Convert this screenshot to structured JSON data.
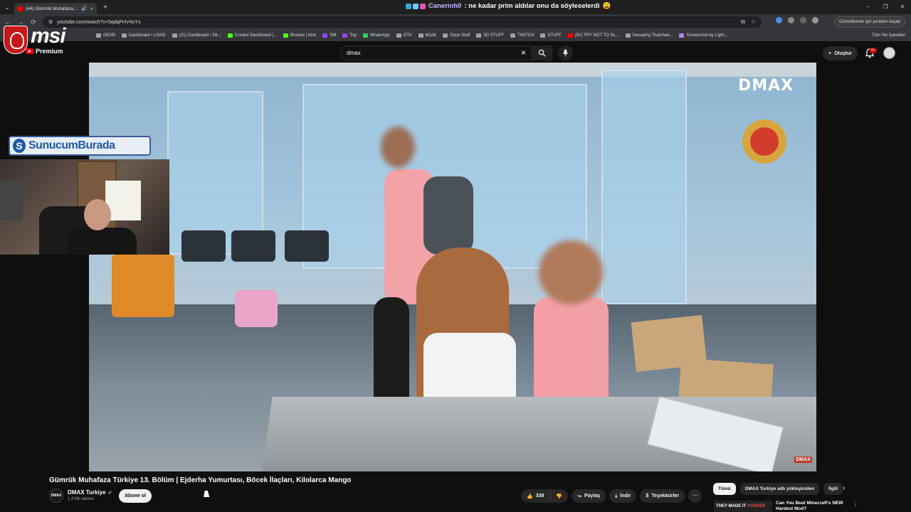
{
  "browser": {
    "tab": {
      "title": "(44) Gümrük Muhafaza Türk",
      "icon": "youtube-icon"
    },
    "url": "youtube.com/watch?v=5qdqFHV4oYs",
    "restart_label": "Güncellemek için yeniden başlat",
    "window_title": {
      "user": "Canerinh0",
      "message": ": ne kadar prim aldılar onu da söyleselerdi",
      "emoji": "😩"
    },
    "bookmarks": [
      {
        "label": "GEAR",
        "icon": "folder-icon",
        "color": "#9aa0a6"
      },
      {
        "label": "Dashboard • LIVAD",
        "icon": "globe-icon",
        "color": "#9aa0a6"
      },
      {
        "label": "(21) Dashboard / Str...",
        "icon": "twitter-icon",
        "color": "#9aa0a6"
      },
      {
        "label": "Creator Dashboard |...",
        "icon": "kick-icon",
        "color": "#53fc18"
      },
      {
        "label": "Browse | Kick",
        "icon": "kick-icon",
        "color": "#53fc18"
      },
      {
        "label": "SM",
        "icon": "twitch-icon",
        "color": "#9146ff"
      },
      {
        "label": "Top",
        "icon": "twitch-icon",
        "color": "#9146ff"
      },
      {
        "label": "WhatsApp",
        "icon": "whatsapp-icon",
        "color": "#25d366"
      },
      {
        "label": "GTA",
        "icon": "folder-icon",
        "color": "#9aa0a6"
      },
      {
        "label": "Müzik",
        "icon": "folder-icon",
        "color": "#9aa0a6"
      },
      {
        "label": "Oyun Stuff",
        "icon": "folder-icon",
        "color": "#9aa0a6"
      },
      {
        "label": "3D STUFF",
        "icon": "folder-icon",
        "color": "#9aa0a6"
      },
      {
        "label": "TWITCH",
        "icon": "folder-icon",
        "color": "#9aa0a6"
      },
      {
        "label": "STUFF",
        "icon": "folder-icon",
        "color": "#9aa0a6"
      },
      {
        "label": "(91) TRY NOT TO SL...",
        "icon": "youtube-icon",
        "color": "#ff0000"
      },
      {
        "label": "Decaying Thatched...",
        "icon": "globe-icon",
        "color": "#9aa0a6"
      },
      {
        "label": "Screenshot by Light...",
        "icon": "lightshot-icon",
        "color": "#b084f5"
      }
    ],
    "bookmarks_right": "Tüm Yer İşaretleri"
  },
  "overlay": {
    "brand": "msi",
    "sponsor": "SunucumBurada"
  },
  "youtube": {
    "logo_label": "Premium",
    "search": {
      "value": "dmax",
      "placeholder": "Ara"
    },
    "create_label": "Oluştur",
    "notifications": "9+",
    "video": {
      "channel_watermark": "DMAX",
      "corner_badge": "DMAX",
      "title": "Gümrük Muhafaza Türkiye 13. Bölüm | Ejderha Yumurtası, Böcek İlaçları, Kilolarca Mango"
    },
    "channel": {
      "name": "DMAX Turkiye",
      "avatar_text": "DMAX",
      "subscribers": "1,3 Mn abone",
      "subscribe_label": "Abone ol"
    },
    "actions": {
      "likes": "339",
      "share": "Paylaş",
      "download": "İndir",
      "thanks": "Teşekkürler"
    },
    "chips": [
      "Tümü",
      "DMAX Turkiye adlı yükleyiciden",
      "İlgili"
    ],
    "recommendation": {
      "thumb_text_1": "THEY MADE IT",
      "thumb_text_2": "HARDER",
      "title": "Can You Beat Minecraft's NEW Hardest Mod?"
    }
  }
}
